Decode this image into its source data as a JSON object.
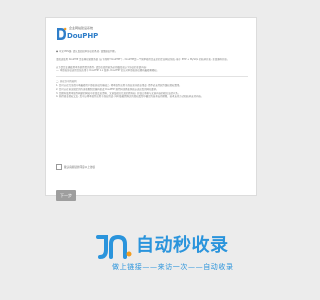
{
  "installer": {
    "logo": {
      "brand": "DouPHP",
      "tagline": "企业网站建设系统",
      "icon": "douphp-logo-icon"
    },
    "paragraphs": [
      "● 中文CMS版, 请认真阅读本协议的条款, 谨慎做出判断。",
      "请阅读使用 DouPHP 企业网站管理系统 (以下简称“DouPHP”) , DouPHP是一个简单易用且安全的企业网站系统, 基于 PHP + MySQL 的技术开发, 全部源码开放。",
      "以下是您正确使用本系统所需的条件, 请您在使用前务必仔细阅读以下协议的全部内容:",
      "一. 本授权协议适用且仅适用于 DouPHP 1.x 版本, DouPHP 官方对本授权协议拥有最终解释权。"
    ],
    "terms_heading": "二. 协议许可的权利",
    "terms": [
      "1. 您可以在完全遵守本最终用户授权协议的基础上, 将本软件应用于商业或非商业用途, 而不必支付软件版权授权费用。",
      "2. 您可以在协议规定的约束和限制范围内修改 DouPHP 源代码或界面风格以适应您的网站要求。",
      "3. 您拥有使用本软件构建的网站中全部会员资料、文章及相关信息的所有权, 并独立承担与文章内容的相关法律义务。",
      "4. 获得商业授权之后, 您可以将本软件应用于商业用途, 同时依据所购买的授权类型中确定的技术支持期限、技术支持方式和技术支持内容。"
    ],
    "agree_label": "我认真阅读并同意以上协议",
    "next_label": "下一步"
  },
  "watermark": {
    "icon": "link-logo-icon",
    "title": "自动秒收录",
    "subtitle": "做上链接——来访一次——自动收录"
  },
  "colors": {
    "page_background": "#ececec",
    "brand_blue": "#2f7ec9",
    "watermark_blue": "#2a94dc",
    "button_gray": "#9e9e9e"
  }
}
